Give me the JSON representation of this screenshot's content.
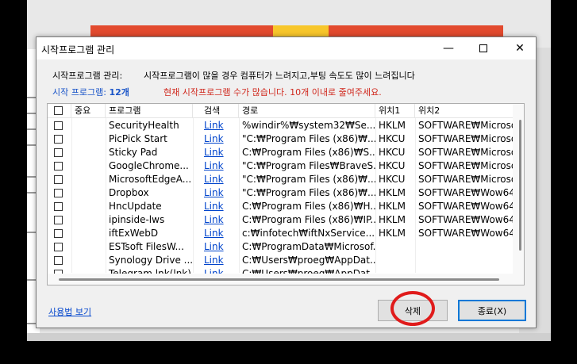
{
  "window": {
    "title": "시작프로그램 관리",
    "minimize_glyph": "—",
    "close_glyph": "✕"
  },
  "info": {
    "manage_label": "시작프로그램 관리:",
    "manage_text": "시작프로그램이 많을 경우 컴퓨터가 느려지고,부팅 속도도 많이 느려집니다",
    "count_label": "시작 프로그램:",
    "count_value": "12개",
    "warning_text": "현재 시작프로그램 수가 많습니다. 10개 이내로 줄여주세요."
  },
  "table": {
    "columns": [
      "",
      "중요",
      "프로그램",
      "검색",
      "경로",
      "위치1",
      "위치2"
    ],
    "rows": [
      {
        "program": "SecurityHealth",
        "search": "Link",
        "path": "%windir%₩system32₩Se...",
        "loc1": "HKLM",
        "loc2": "SOFTWARE₩Microso"
      },
      {
        "program": "PicPick Start",
        "search": "Link",
        "path": "\"C:₩Program Files (x86)₩...",
        "loc1": "HKCU",
        "loc2": "SOFTWARE₩Microso"
      },
      {
        "program": "Sticky Pad",
        "search": "Link",
        "path": "C:₩Program Files (x86)₩S...",
        "loc1": "HKCU",
        "loc2": "SOFTWARE₩Microso"
      },
      {
        "program": "GoogleChrome...",
        "search": "Link",
        "path": "\"C:₩Program Files₩BraveS...",
        "loc1": "HKCU",
        "loc2": "SOFTWARE₩Microso"
      },
      {
        "program": "MicrosoftEdgeA...",
        "search": "Link",
        "path": "\"C:₩Program Files (x86)₩...",
        "loc1": "HKCU",
        "loc2": "SOFTWARE₩Microso"
      },
      {
        "program": "Dropbox",
        "search": "Link",
        "path": "\"C:₩Program Files (x86)₩...",
        "loc1": "HKLM",
        "loc2": "SOFTWARE₩Wow64"
      },
      {
        "program": "HncUpdate",
        "search": "Link",
        "path": "C:₩Program Files (x86)₩H...",
        "loc1": "HKLM",
        "loc2": "SOFTWARE₩Wow64"
      },
      {
        "program": "ipinside-lws",
        "search": "Link",
        "path": "C:₩Program Files (x86)₩IP...",
        "loc1": "HKLM",
        "loc2": "SOFTWARE₩Wow64"
      },
      {
        "program": "iftExWebD",
        "search": "Link",
        "path": "c:₩infotech₩iftNxService...",
        "loc1": "HKLM",
        "loc2": "SOFTWARE₩Wow64"
      },
      {
        "program": "ESTsoft FilesW...",
        "search": "Link",
        "path": "C:₩ProgramData₩Microsof...",
        "loc1": "",
        "loc2": ""
      },
      {
        "program": "Synology Drive ...",
        "search": "Link",
        "path": "C:₩Users₩proeg₩AppDat...",
        "loc1": "",
        "loc2": ""
      },
      {
        "program": "Telegram.lnk(lnk)",
        "search": "Link",
        "path": "C:₩Users₩proeg₩AppDat...",
        "loc1": "",
        "loc2": ""
      }
    ]
  },
  "footer": {
    "help_link": "사용법 보기",
    "delete_button": "삭제",
    "exit_button": "종료(X)"
  },
  "colors": {
    "highlight_circle": "#e01b1b",
    "count_blue": "#1a55c8",
    "warning_red": "#d0281d"
  }
}
